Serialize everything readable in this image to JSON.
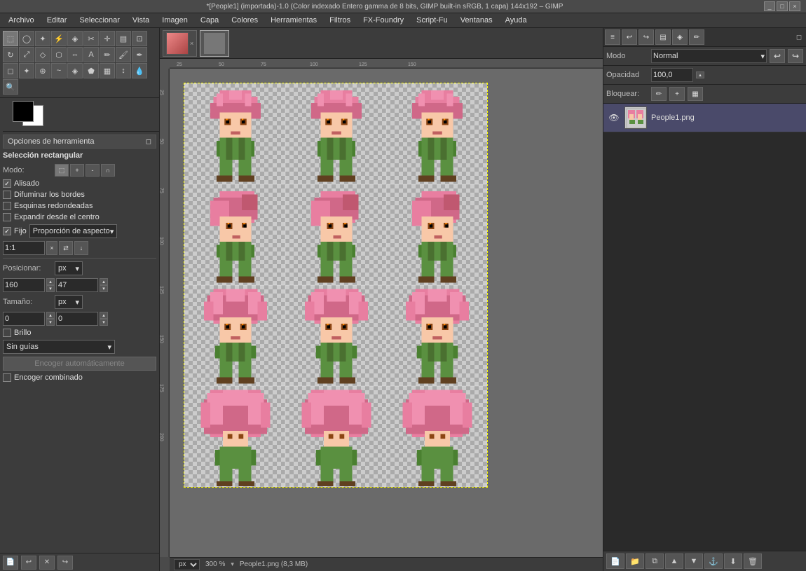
{
  "titlebar": {
    "title": "*[People1] (importada)-1.0 (Color indexado Entero gamma de 8 bits, GIMP built-in sRGB, 1 capa) 144x192 – GIMP",
    "minimize": "_",
    "maximize": "□",
    "close": "×"
  },
  "menubar": {
    "items": [
      "Archivo",
      "Editar",
      "Seleccionar",
      "Vista",
      "Imagen",
      "Capa",
      "Colores",
      "Herramientas",
      "Filtros",
      "FX-Foundry",
      "Script-Fu",
      "Ventanas",
      "Ayuda"
    ]
  },
  "toolbar": {
    "tool_options_label": "Opciones de herramienta",
    "tool_name": "Selección rectangular",
    "mode_label": "Modo:",
    "smooth_label": "Alisado",
    "feather_label": "Difuminar los bordes",
    "rounded_label": "Esquinas redondeadas",
    "expand_label": "Expandir desde el centro",
    "fixed_label": "Fijo",
    "aspect_label": "Proporción de aspecto",
    "ratio_value": "1:1",
    "position_label": "Posicionar:",
    "position_unit": "px",
    "pos_x": "160",
    "pos_y": "47",
    "size_label": "Tamaño:",
    "size_unit": "px",
    "size_w": "0",
    "size_h": "0",
    "brightness_label": "Brillo",
    "guides_label": "Sin guías",
    "auto_shrink_label": "Encoger automáticamente",
    "combined_shrink_label": "Encoger combinado"
  },
  "status": {
    "unit": "px",
    "zoom": "300 %",
    "filename": "People1.png (8,3 MB)"
  },
  "layers": {
    "mode_label": "Modo",
    "mode_value": "Normal",
    "opacity_label": "Opacidad",
    "opacity_value": "100,0",
    "lock_label": "Bloquear:",
    "layer_name": "People1.png"
  },
  "icons": {
    "undo": "↩",
    "redo": "↪",
    "eye": "👁",
    "pencil": "✏",
    "chain": "⛓",
    "checker": "▦",
    "zoom_in": "+",
    "zoom_out": "-",
    "new_layer": "📄",
    "up": "▲",
    "down": "▼",
    "delete": "🗑",
    "anchor": "⚓",
    "merge": "⬇",
    "chevron": "▾",
    "arrow_down": "▾",
    "arrow_up": "▴",
    "expand": "◻"
  }
}
